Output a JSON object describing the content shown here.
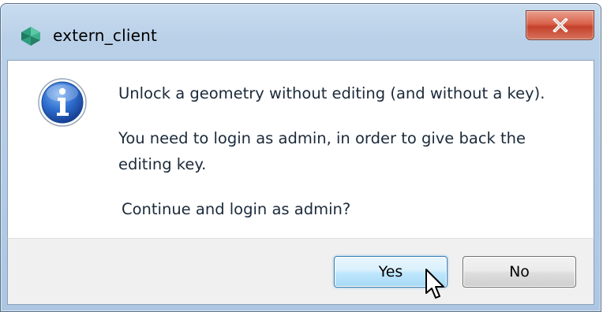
{
  "window": {
    "title": "extern_client",
    "close_label": "Close",
    "app_icon": "app-logo-icon"
  },
  "dialog": {
    "icon": "info-icon",
    "message_line1": "Unlock a geometry without editing (and without a key).",
    "message_line2": "You need to login as admin, in order to give back the editing key.",
    "message_line3": "Continue and login as admin?"
  },
  "buttons": {
    "yes_label": "Yes",
    "no_label": "No"
  },
  "colors": {
    "titlebar": "#b9d0e8",
    "close_button": "#c4412a",
    "default_button_border": "#3c7fb1",
    "footer": "#f0f0f0"
  }
}
